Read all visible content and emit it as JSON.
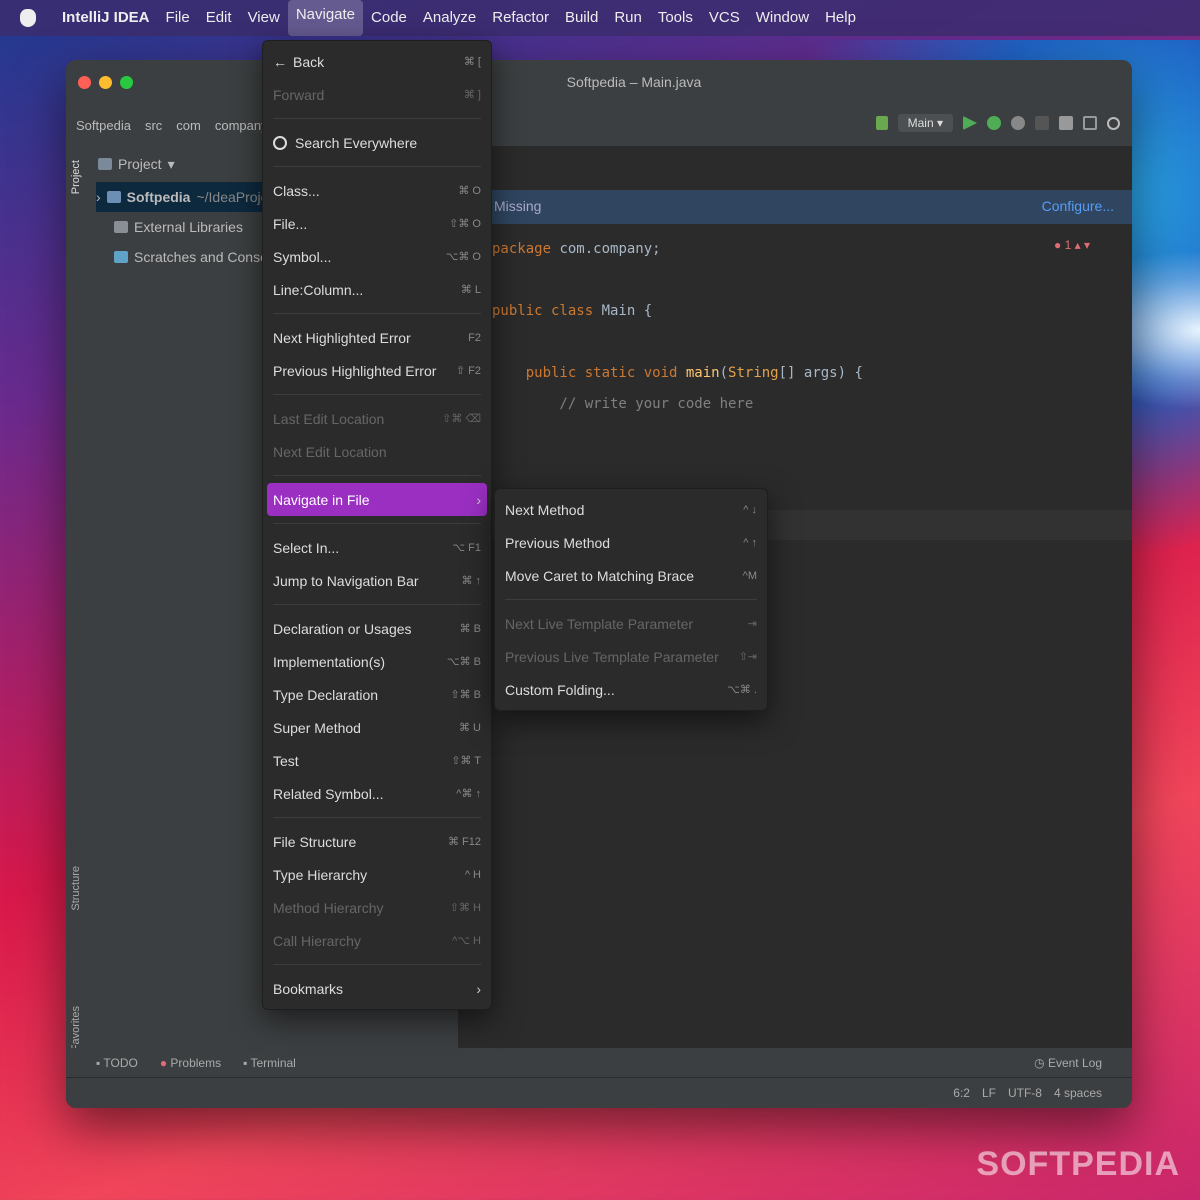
{
  "menubar": {
    "items": [
      "IntelliJ IDEA",
      "File",
      "Edit",
      "View",
      "Navigate",
      "Code",
      "Analyze",
      "Refactor",
      "Build",
      "Run",
      "Tools",
      "VCS",
      "Window",
      "Help"
    ]
  },
  "window": {
    "title": "Softpedia – Main.java",
    "breadcrumbs": [
      "Softpedia",
      "src",
      "com",
      "company"
    ],
    "run_config": "Main"
  },
  "sidebar": {
    "project_tab": "Project",
    "structure_tab": "Structure",
    "favorites_tab": "Favorites"
  },
  "project": {
    "header": "Project",
    "items": [
      {
        "label": "Softpedia",
        "suffix": "~/IdeaProjects"
      },
      {
        "label": "External Libraries"
      },
      {
        "label": "Scratches and Consoles"
      }
    ]
  },
  "editor": {
    "banner_text": "Missing",
    "banner_action": "Configure...",
    "error_count": "1",
    "code": [
      [
        "kw:package ",
        "txt:com.company;"
      ],
      [],
      [
        "kw:public class ",
        "txt:Main {"
      ],
      [],
      [
        "kw:    public static void ",
        "fn:main",
        "txt:(",
        "ty:String",
        "txt:[] args) {"
      ],
      [
        "cm:        // write your code here"
      ]
    ]
  },
  "bottom": {
    "tabs": [
      "TODO",
      "Problems",
      "Terminal"
    ],
    "event_log": "Event Log",
    "status": [
      "6:2",
      "LF",
      "UTF-8",
      "4 spaces"
    ]
  },
  "navigate_menu": {
    "groups": [
      [
        {
          "label": "Back",
          "shortcut": "⌘ [",
          "icon": "back-arrow-icon"
        },
        {
          "label": "Forward",
          "shortcut": "⌘ ]",
          "disabled": true
        }
      ],
      [
        {
          "label": "Search Everywhere",
          "icon": "search-icon"
        }
      ],
      [
        {
          "label": "Class...",
          "shortcut": "⌘ O"
        },
        {
          "label": "File...",
          "shortcut": "⇧⌘ O"
        },
        {
          "label": "Symbol...",
          "shortcut": "⌥⌘ O"
        },
        {
          "label": "Line:Column...",
          "shortcut": "⌘ L"
        }
      ],
      [
        {
          "label": "Next Highlighted Error",
          "shortcut": "F2"
        },
        {
          "label": "Previous Highlighted Error",
          "shortcut": "⇧ F2"
        }
      ],
      [
        {
          "label": "Last Edit Location",
          "shortcut": "⇧⌘ ⌫",
          "disabled": true
        },
        {
          "label": "Next Edit Location",
          "disabled": true
        }
      ],
      [
        {
          "label": "Navigate in File",
          "submenu": true,
          "highlighted": true
        }
      ],
      [
        {
          "label": "Select In...",
          "shortcut": "⌥ F1"
        },
        {
          "label": "Jump to Navigation Bar",
          "shortcut": "⌘ ↑"
        }
      ],
      [
        {
          "label": "Declaration or Usages",
          "shortcut": "⌘ B"
        },
        {
          "label": "Implementation(s)",
          "shortcut": "⌥⌘ B"
        },
        {
          "label": "Type Declaration",
          "shortcut": "⇧⌘ B"
        },
        {
          "label": "Super Method",
          "shortcut": "⌘ U"
        },
        {
          "label": "Test",
          "shortcut": "⇧⌘ T"
        },
        {
          "label": "Related Symbol...",
          "shortcut": "^⌘ ↑"
        }
      ],
      [
        {
          "label": "File Structure",
          "shortcut": "⌘ F12"
        },
        {
          "label": "Type Hierarchy",
          "shortcut": "^ H"
        },
        {
          "label": "Method Hierarchy",
          "shortcut": "⇧⌘ H",
          "disabled": true
        },
        {
          "label": "Call Hierarchy",
          "shortcut": "^⌥ H",
          "disabled": true
        }
      ],
      [
        {
          "label": "Bookmarks",
          "submenu": true
        }
      ]
    ]
  },
  "submenu": {
    "groups": [
      [
        {
          "label": "Next Method",
          "shortcut": "^ ↓"
        },
        {
          "label": "Previous Method",
          "shortcut": "^ ↑"
        },
        {
          "label": "Move Caret to Matching Brace",
          "shortcut": "^M"
        }
      ],
      [
        {
          "label": "Next Live Template Parameter",
          "shortcut": "⇥",
          "disabled": true
        },
        {
          "label": "Previous Live Template Parameter",
          "shortcut": "⇧⇥",
          "disabled": true
        },
        {
          "label": "Custom Folding...",
          "shortcut": "⌥⌘ ."
        }
      ]
    ]
  },
  "watermark": "SOFTPEDIA"
}
